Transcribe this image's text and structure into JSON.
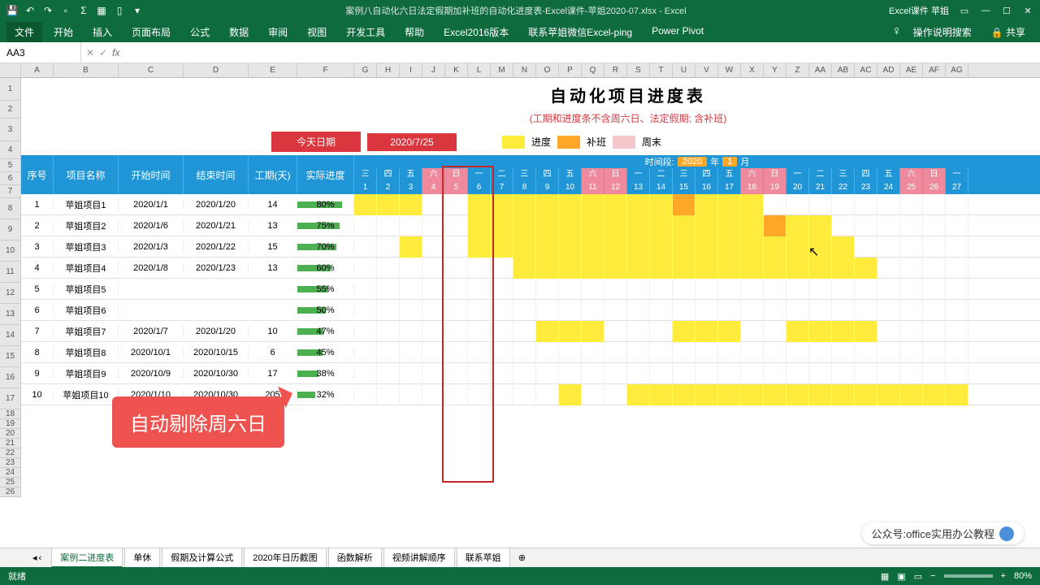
{
  "titlebar": {
    "title": "案例八自动化六日法定假期加补班的自动化进度表-Excel课件-苹姐2020-07.xlsx - Excel",
    "user": "Excel课件 苹姐"
  },
  "ribbon": {
    "tabs": [
      "文件",
      "开始",
      "插入",
      "页面布局",
      "公式",
      "数据",
      "审阅",
      "视图",
      "开发工具",
      "帮助",
      "Excel2016版本",
      "联系苹姐微信Excel-ping",
      "Power Pivot"
    ],
    "search": "操作说明搜索",
    "share": "共享"
  },
  "nameBox": "AA3",
  "columns": [
    "A",
    "B",
    "C",
    "D",
    "E",
    "F",
    "G",
    "H",
    "I",
    "J",
    "K",
    "L",
    "M",
    "N",
    "O",
    "P",
    "Q",
    "R",
    "S",
    "T",
    "U",
    "V",
    "W",
    "X",
    "Y",
    "Z",
    "AA",
    "AB",
    "AC",
    "AD",
    "AE",
    "AF",
    "AG"
  ],
  "bigTitle": "自动化项目进度表",
  "subtitle": "(工期和进度条不含周六日、法定假期; 含补班)",
  "today": {
    "label": "今天日期",
    "date": "2020/7/25"
  },
  "legend": {
    "progress": "进度",
    "overtime": "补班",
    "weekend": "周末"
  },
  "headers": {
    "seq": "序号",
    "name": "项目名称",
    "start": "开始时间",
    "end": "结束时间",
    "duration": "工期(天)",
    "actual": "实际进度",
    "period": "时间段:",
    "year": "2020",
    "yearUnit": "年",
    "month": "1",
    "monthUnit": "月"
  },
  "weekdays": [
    "三",
    "四",
    "五",
    "六",
    "日",
    "一",
    "二",
    "三",
    "四",
    "五",
    "六",
    "日",
    "一",
    "二",
    "三",
    "四",
    "五",
    "六",
    "日",
    "一",
    "二",
    "三",
    "四",
    "五",
    "六",
    "日",
    "一"
  ],
  "dayNums": [
    1,
    2,
    3,
    4,
    5,
    6,
    7,
    8,
    9,
    10,
    11,
    12,
    13,
    14,
    15,
    16,
    17,
    18,
    19,
    20,
    21,
    22,
    23,
    24,
    25,
    26,
    27
  ],
  "weekendIdx": [
    3,
    4,
    10,
    11,
    17,
    18,
    24,
    25
  ],
  "rows": [
    {
      "n": 1,
      "name": "苹姐项目1",
      "s": "2020/1/1",
      "e": "2020/1/20",
      "d": 14,
      "p": 80,
      "bars": [
        [
          0,
          2,
          "prog"
        ],
        [
          5,
          13,
          "prog"
        ],
        [
          14,
          14,
          "ot"
        ],
        [
          15,
          17,
          "prog"
        ]
      ]
    },
    {
      "n": 2,
      "name": "苹姐项目2",
      "s": "2020/1/6",
      "e": "2020/1/21",
      "d": 13,
      "p": 75,
      "bars": [
        [
          5,
          17,
          "prog"
        ],
        [
          18,
          18,
          "ot"
        ],
        [
          19,
          20,
          "prog"
        ]
      ]
    },
    {
      "n": 3,
      "name": "苹姐项目3",
      "s": "2020/1/3",
      "e": "2020/1/22",
      "d": 15,
      "p": 70,
      "bars": [
        [
          2,
          2,
          "prog"
        ],
        [
          5,
          21,
          "prog"
        ]
      ]
    },
    {
      "n": 4,
      "name": "苹姐项目4",
      "s": "2020/1/8",
      "e": "2020/1/23",
      "d": 13,
      "p": 60,
      "bars": [
        [
          7,
          22,
          "prog"
        ]
      ]
    },
    {
      "n": 5,
      "name": "苹姐项目5",
      "s": "",
      "e": "",
      "d": "",
      "p": 55,
      "bars": []
    },
    {
      "n": 6,
      "name": "苹姐项目6",
      "s": "",
      "e": "",
      "d": "",
      "p": 50,
      "bars": []
    },
    {
      "n": 7,
      "name": "苹姐项目7",
      "s": "2020/1/7",
      "e": "2020/1/20",
      "d": 10,
      "p": 47,
      "bars": [
        [
          8,
          10,
          "prog"
        ],
        [
          14,
          16,
          "prog"
        ],
        [
          19,
          22,
          "prog"
        ]
      ]
    },
    {
      "n": 8,
      "name": "苹姐项目8",
      "s": "2020/10/1",
      "e": "2020/10/15",
      "d": 6,
      "p": 45,
      "bars": []
    },
    {
      "n": 9,
      "name": "苹姐项目9",
      "s": "2020/10/9",
      "e": "2020/10/30",
      "d": 17,
      "p": 38,
      "bars": []
    },
    {
      "n": 10,
      "name": "苹姐项目10",
      "s": "2020/1/10",
      "e": "2020/10/30",
      "d": 205,
      "p": 32,
      "bars": [
        [
          9,
          9,
          "prog"
        ],
        [
          12,
          26,
          "prog"
        ]
      ]
    }
  ],
  "callout": "自动剔除周六日",
  "sheetTabs": [
    "案例二进度表",
    "单休",
    "假期及计算公式",
    "2020年日历截图",
    "函数解析",
    "视频讲解顺序",
    "联系苹姐"
  ],
  "activeSheet": 0,
  "status": {
    "left": "就绪",
    "zoom": "80%"
  },
  "watermark": "公众号:office实用办公教程",
  "colWidths": {
    "seq": 40,
    "name": 80,
    "start": 80,
    "end": 80,
    "dur": 60,
    "prog": 70
  }
}
